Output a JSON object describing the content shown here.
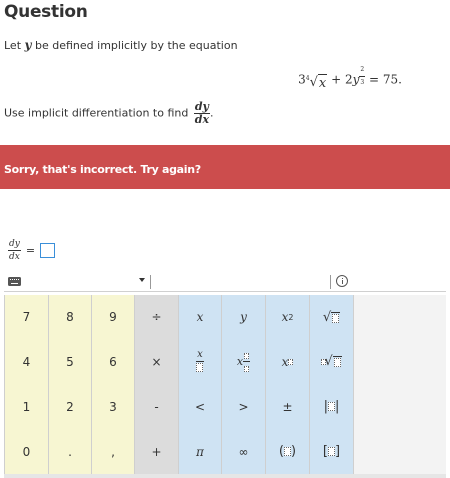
{
  "question": {
    "heading": "Question",
    "intro_before_var": "Let ",
    "var_y": "y",
    "intro_after_var": " be defined implicitly by the equation",
    "equation": {
      "coef1": "3",
      "root_index": "4",
      "radicand": "x",
      "plus": "+",
      "coef2": "2",
      "var": "y",
      "exp_num": "2",
      "exp_den": "3",
      "equals_rhs": "= 75."
    },
    "instruction": "Use implicit differentiation to find",
    "deriv_num": "dy",
    "deriv_den": "dx",
    "instruction_end": "."
  },
  "feedback": {
    "message": "Sorry, that's incorrect. Try again?",
    "color": "#cc4d4d"
  },
  "answer": {
    "lhs_num": "dy",
    "lhs_den": "dx",
    "equals": "="
  },
  "keypad": {
    "digits": [
      "7",
      "8",
      "9",
      "4",
      "5",
      "6",
      "1",
      "2",
      "3",
      "0",
      ".",
      ","
    ],
    "ops": [
      "÷",
      "×",
      "-",
      "+"
    ],
    "symbols": {
      "x": "x",
      "y": "y",
      "x_var": "x",
      "lt": "<",
      "gt": ">",
      "pm": "±",
      "pi": "π",
      "inf": "∞",
      "exp_base": "x",
      "exp_power": "2",
      "sub_base": "x",
      "root_index": "□"
    },
    "colors": {
      "digit_keys": "#f7f6d2",
      "operator_keys": "#dcdcdc",
      "math_keys": "#cfe3f3",
      "answer_box_border": "#3a8fd9"
    }
  }
}
